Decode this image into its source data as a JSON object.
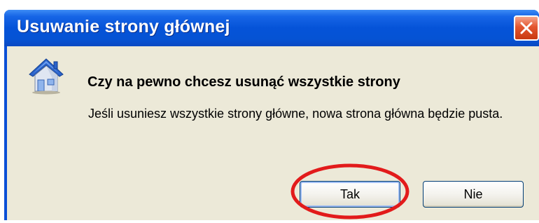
{
  "dialog": {
    "title": "Usuwanie strony głównej",
    "heading": "Czy na pewno chcesz usunąć wszystkie strony",
    "message": "Jeśli usuniesz wszystkie strony główne, nowa strona główna będzie pusta.",
    "icon": "home-icon",
    "close_icon": "close-icon",
    "yes_label": "Tak",
    "no_label": "Nie"
  },
  "colors": {
    "titlebar": "#0553d8",
    "client_background": "#ece9d8",
    "close_button": "#e3562f",
    "highlight_ring": "#e21b1b"
  }
}
